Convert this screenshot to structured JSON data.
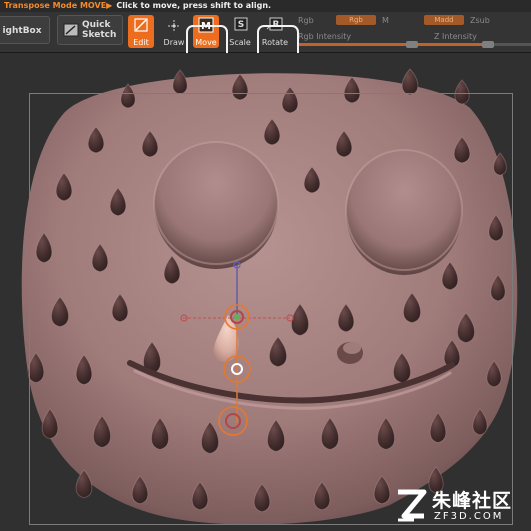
{
  "status": {
    "mode": "Transpose Mode MOVE",
    "arrow": "▶",
    "hint": "Click to move, press shift to align."
  },
  "toolbar": {
    "lightbox_label": "ightBox",
    "quicksketch_label_line1": "Quick",
    "quicksketch_label_line2": "Sketch",
    "edit_label": "Edit",
    "draw_label": "Draw",
    "move_label": "Move",
    "scale_label": "Scale",
    "rotate_label": "Rotate",
    "icons": {
      "edit": "edit-icon",
      "draw": "draw-icon",
      "move": "move-icon",
      "scale": "scale-icon",
      "rotate": "rotate-icon"
    },
    "active_tools": [
      "Edit",
      "Move"
    ]
  },
  "sliders": {
    "rgb_label": "Rgb",
    "rgb_box": "Rgb",
    "m_label": "M",
    "madd_box": "Madd",
    "zsub_label": "Zsub",
    "rgb_intensity_label": "Rgb Intensity",
    "z_intensity_label": "Z Intensity"
  },
  "viewport": {
    "model": "strawberry-head-sculpt",
    "gizmo": "transpose-move-line"
  },
  "watermark": {
    "text": "朱峰社区",
    "sub": "ZF3D.COM"
  },
  "colors": {
    "accent": "#ec6d1e",
    "clay": "#a47f7e",
    "panel": "#343434",
    "viewport_bg": "#303030"
  }
}
